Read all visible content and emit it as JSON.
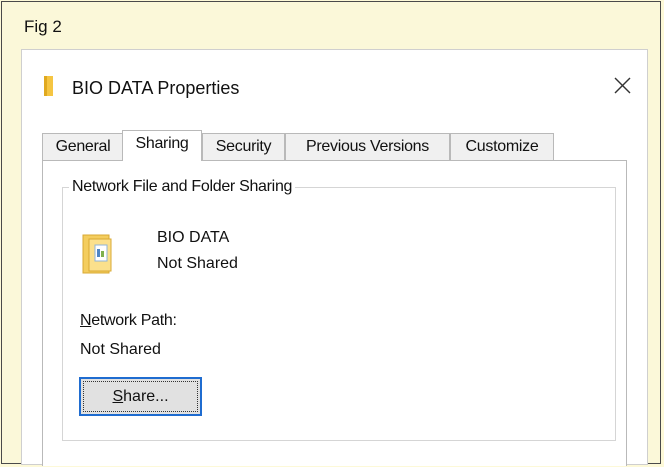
{
  "figure": {
    "label": "Fig 2"
  },
  "window": {
    "title": "BIO DATA Properties",
    "close_glyph": "✕"
  },
  "tabs": [
    {
      "label": "General",
      "active": false
    },
    {
      "label": "Sharing",
      "active": true
    },
    {
      "label": "Security",
      "active": false
    },
    {
      "label": "Previous Versions",
      "active": false
    },
    {
      "label": "Customize",
      "active": false
    }
  ],
  "sharing": {
    "group_title": "Network File and Folder Sharing",
    "item_name": "BIO DATA",
    "item_status": "Not Shared",
    "network_path_label_mnemonic": "N",
    "network_path_label_rest": "etwork Path:",
    "network_path_value": "Not Shared",
    "share_button_mnemonic": "S",
    "share_button_rest": "hare..."
  },
  "colors": {
    "page_background": "#fbf8d9",
    "focus_border": "#1f6cd0",
    "folder_yellow": "#f5c542"
  },
  "icons": {
    "title": "folder-icon",
    "item": "shared-folder-icon",
    "close": "close-icon"
  }
}
